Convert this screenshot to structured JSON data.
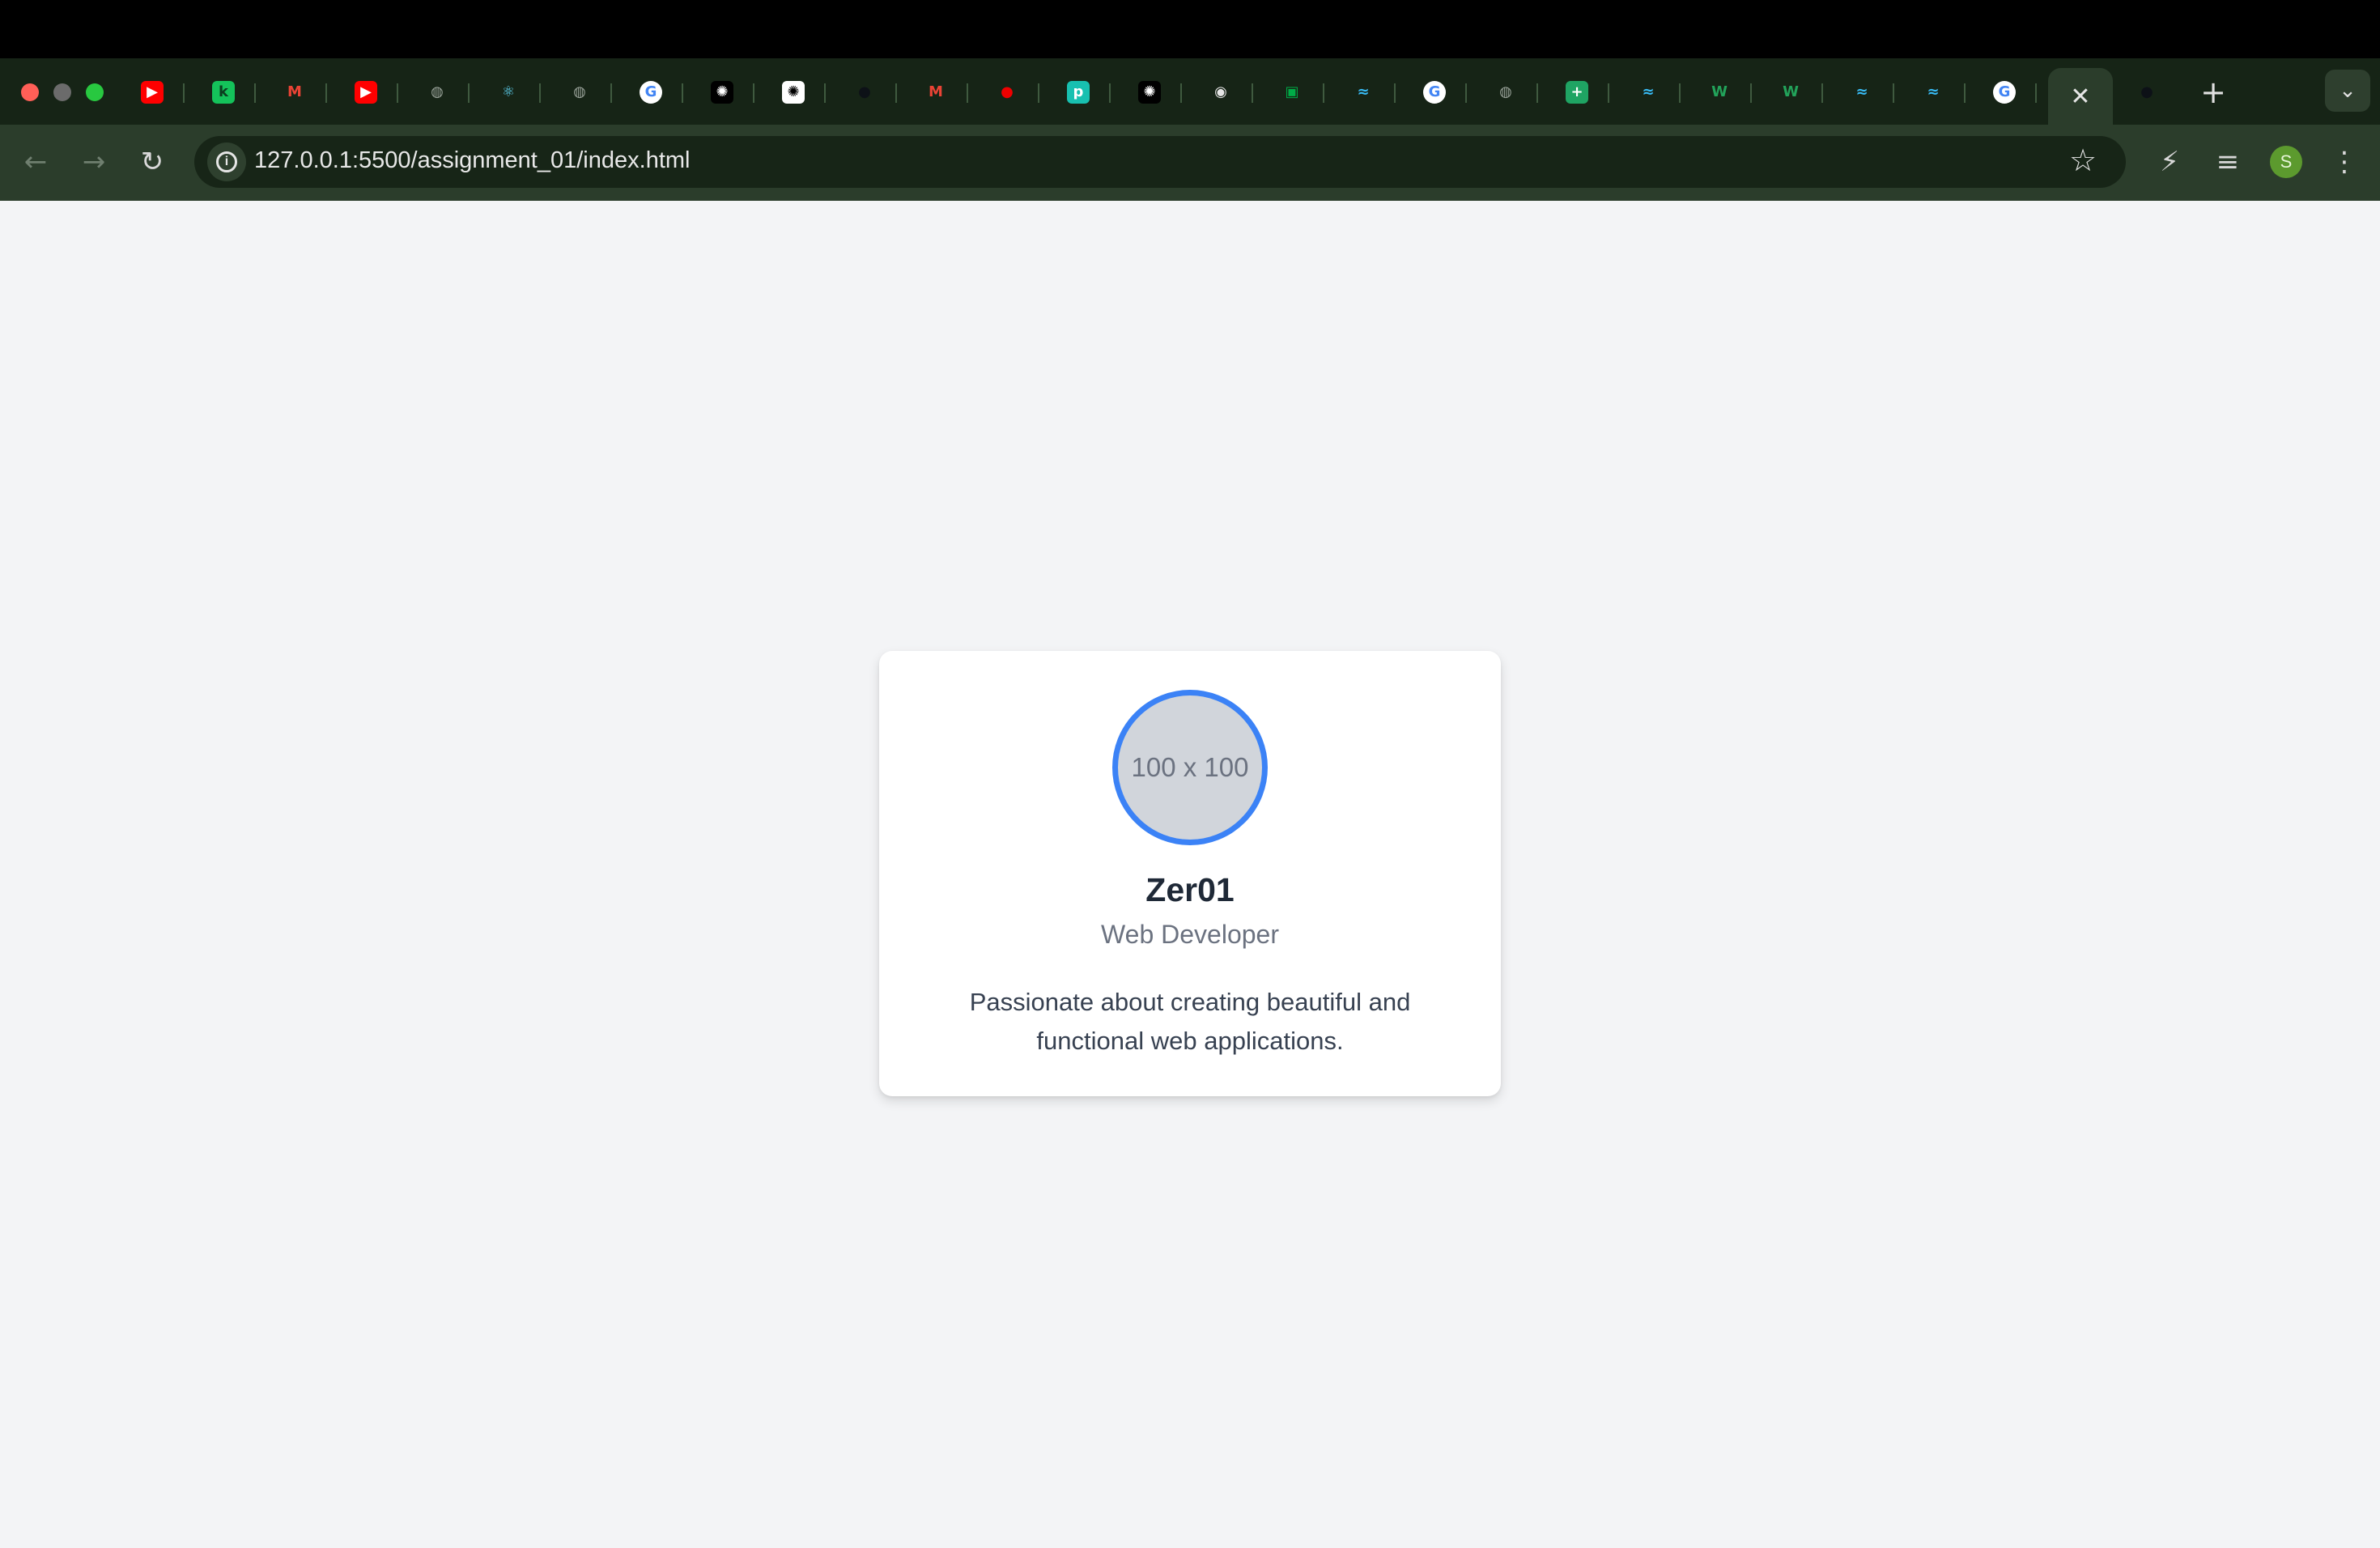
{
  "browser": {
    "tabs": [
      {
        "icon": "youtube-icon",
        "glyph": "▶",
        "bg": "#ff0000",
        "fg": "#ffffff"
      },
      {
        "icon": "leetcode-icon",
        "glyph": "k",
        "bg": "#14c25a",
        "fg": "#0b3d1f"
      },
      {
        "icon": "gmail-icon",
        "glyph": "M",
        "bg": "transparent",
        "fg": "#ea4335"
      },
      {
        "icon": "youtube-icon",
        "glyph": "▶",
        "bg": "#ff0000",
        "fg": "#ffffff"
      },
      {
        "icon": "globe-icon",
        "glyph": "◍",
        "bg": "transparent",
        "fg": "#9aa39a"
      },
      {
        "icon": "react-icon",
        "glyph": "⚛",
        "bg": "transparent",
        "fg": "#61dafb"
      },
      {
        "icon": "globe-icon",
        "glyph": "◍",
        "bg": "transparent",
        "fg": "#9aa39a"
      },
      {
        "icon": "google-icon",
        "glyph": "G",
        "bg": "#ffffff",
        "fg": "#4285f4"
      },
      {
        "icon": "chatgpt-icon",
        "glyph": "✺",
        "bg": "#000000",
        "fg": "#ffffff"
      },
      {
        "icon": "chatgpt-icon",
        "glyph": "✺",
        "bg": "#ffffff",
        "fg": "#000000"
      },
      {
        "icon": "github-icon",
        "glyph": "●",
        "bg": "transparent",
        "fg": "#0d1117"
      },
      {
        "icon": "gmail-icon",
        "glyph": "M",
        "bg": "transparent",
        "fg": "#ea4335"
      },
      {
        "icon": "redhat-icon",
        "glyph": "●",
        "bg": "transparent",
        "fg": "#ee0000"
      },
      {
        "icon": "replit-icon",
        "glyph": "p",
        "bg": "#18c0b0",
        "fg": "#ffffff"
      },
      {
        "icon": "chatgpt-icon",
        "glyph": "✺",
        "bg": "#000000",
        "fg": "#ffffff"
      },
      {
        "icon": "chrome-icon",
        "glyph": "◉",
        "bg": "transparent",
        "fg": "#e6e6e6"
      },
      {
        "icon": "google-meet-icon",
        "glyph": "▣",
        "bg": "transparent",
        "fg": "#00ac47"
      },
      {
        "icon": "tailwind-icon",
        "glyph": "≈",
        "bg": "transparent",
        "fg": "#38bdf8"
      },
      {
        "icon": "google-icon",
        "glyph": "G",
        "bg": "#ffffff",
        "fg": "#4285f4"
      },
      {
        "icon": "globe-icon",
        "glyph": "◍",
        "bg": "transparent",
        "fg": "#9aa39a"
      },
      {
        "icon": "google-sheets-icon",
        "glyph": "+",
        "bg": "#1fa463",
        "fg": "#ffffff"
      },
      {
        "icon": "tailwind-icon",
        "glyph": "≈",
        "bg": "transparent",
        "fg": "#38bdf8"
      },
      {
        "icon": "w-icon",
        "glyph": "W",
        "bg": "transparent",
        "fg": "#22a35a"
      },
      {
        "icon": "w-icon",
        "glyph": "W",
        "bg": "transparent",
        "fg": "#22a35a"
      },
      {
        "icon": "tailwind-icon",
        "glyph": "≈",
        "bg": "transparent",
        "fg": "#38bdf8"
      },
      {
        "icon": "tailwind-icon",
        "glyph": "≈",
        "bg": "transparent",
        "fg": "#38bdf8"
      },
      {
        "icon": "google-icon",
        "glyph": "G",
        "bg": "#ffffff",
        "fg": "#4285f4"
      }
    ],
    "active_tab_close": "✕",
    "after_active_tab": {
      "icon": "github-icon",
      "glyph": "●",
      "fg": "#0d1117"
    },
    "new_tab": "+",
    "tab_search": "⌄",
    "nav": {
      "back": "←",
      "forward": "→",
      "reload": "↻"
    },
    "site_info": "i",
    "url": "127.0.0.1:5500/assignment_01/index.html",
    "bookmark_star": "☆",
    "extensions": {
      "ext1": "⚡",
      "media": "≡"
    },
    "profile_initial": "S",
    "menu": "⋮"
  },
  "card": {
    "image_placeholder": "100 x 100",
    "name": "Zer01",
    "role": "Web Developer",
    "bio": "Passionate about creating beautiful and functional web applications."
  },
  "colors": {
    "accent": "#3b82f6",
    "page_bg": "#f3f4f6",
    "tabstrip_bg": "#162416",
    "toolbar_bg": "#2b3d2b"
  }
}
